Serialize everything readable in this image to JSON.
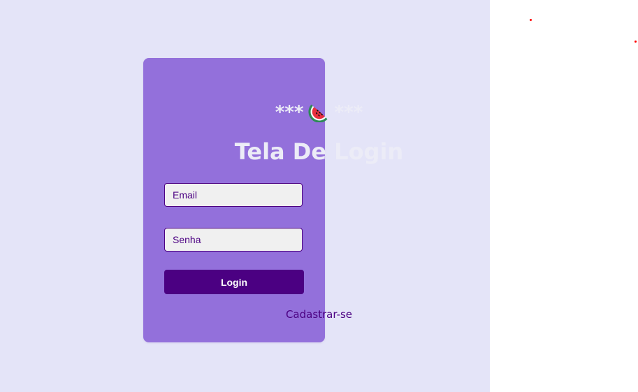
{
  "colors": {
    "background_left": "#e4e4f8",
    "background_right": "#ffffff",
    "card": "#9370db",
    "primary": "#4b0082",
    "title": "#ececf7",
    "input_background": "#f0f0f0",
    "red_dot": "#ff0000"
  },
  "emoji": {
    "left_decoration": "***",
    "icon": "watermelon-icon",
    "right_decoration": "***"
  },
  "title": "Tela De Login",
  "form": {
    "email": {
      "placeholder": "Email",
      "value": ""
    },
    "password": {
      "placeholder": "Senha",
      "value": ""
    },
    "login_button": "Login",
    "signup_link": "Cadastrar-se"
  }
}
